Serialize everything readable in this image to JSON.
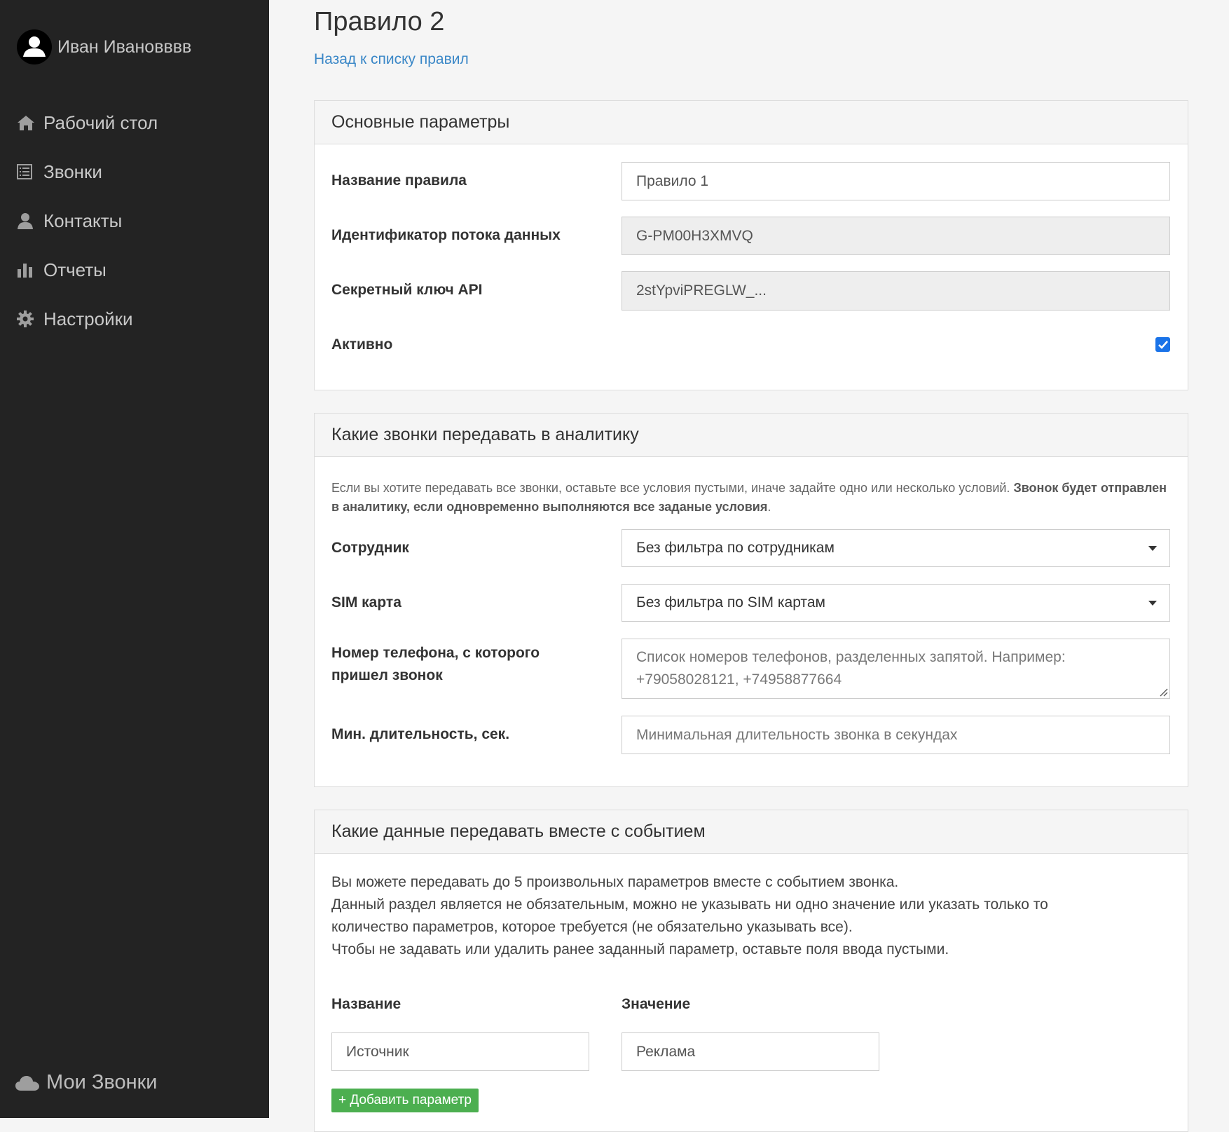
{
  "user": {
    "name": "Иван Ивановввв"
  },
  "nav": [
    {
      "label": "Рабочий стол",
      "icon": "home-icon"
    },
    {
      "label": "Звонки",
      "icon": "list-icon"
    },
    {
      "label": "Контакты",
      "icon": "user-icon"
    },
    {
      "label": "Отчеты",
      "icon": "bar-chart-icon"
    },
    {
      "label": "Настройки",
      "icon": "gear-icon"
    }
  ],
  "brand": {
    "name": "Мои Звонки",
    "icon": "cloud-icon"
  },
  "page": {
    "title": "Правило 2",
    "back_link": "Назад к списку правил"
  },
  "basic": {
    "heading": "Основные параметры",
    "name_label": "Название правила",
    "name_value": "Правило 1",
    "stream_label": "Идентификатор потока данных",
    "stream_value": "G-PM00H3XMVQ",
    "api_label": "Секретный ключ API",
    "api_value": "2stYpviPREGLW_...",
    "active_label": "Активно",
    "active_checked": true
  },
  "filters": {
    "heading": "Какие звонки передавать в аналитику",
    "help_plain": "Если вы хотите передавать все звонки, оставьте все условия пустыми, иначе задайте одно или несколько условий. ",
    "help_bold": "Звонок будет отправлен в аналитику, если одновременно выполняются все заданые условия",
    "help_end": ".",
    "employee_label": "Сотрудник",
    "employee_value": "Без фильтра по сотрудникам",
    "sim_label": "SIM карта",
    "sim_value": "Без фильтра по SIM картам",
    "phone_label": "Номер телефона, с которого пришел звонок",
    "phone_placeholder": "Список номеров телефонов, разделенных запятой. Например: +79058028121, +74958877664",
    "duration_label": "Мин. длительность, сек.",
    "duration_placeholder": "Минимальная длительность звонка в секундах"
  },
  "params": {
    "heading": "Какие данные передавать вместе с событием",
    "info_1": "Вы можете передавать до 5 произвольных параметров вместе с событием звонка.",
    "info_2": "Данный раздел является не обязательным, можно не указывать ни одно значение или указать только то количество параметров, которое требуется (не обязательно указывать все).",
    "info_3": "Чтобы не задавать или удалить ранее заданный параметр, оставьте поля ввода пустыми.",
    "col_name": "Название",
    "col_value": "Значение",
    "row_name": "Источник",
    "row_value": "Реклама",
    "add_button": "+ Добавить параметр"
  },
  "colors": {
    "sidebar_bg": "#232323",
    "link": "#3a87c7",
    "checkbox": "#1a73e8",
    "add_button": "#4caf50"
  }
}
